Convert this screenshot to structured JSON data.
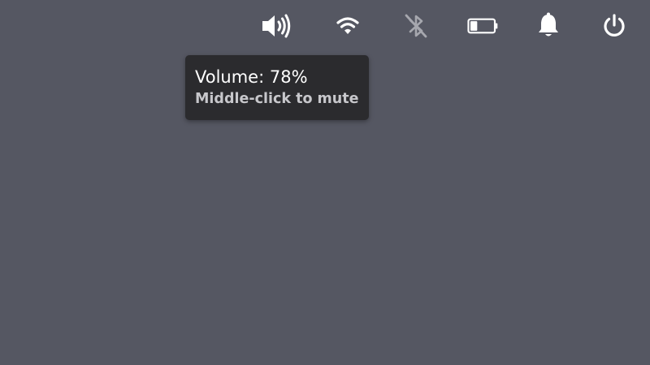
{
  "tray": {
    "icons": [
      {
        "name": "volume-icon"
      },
      {
        "name": "wifi-icon"
      },
      {
        "name": "bluetooth-disabled-icon"
      },
      {
        "name": "battery-icon",
        "level": 0.3
      },
      {
        "name": "bell-icon"
      },
      {
        "name": "power-icon"
      }
    ]
  },
  "tooltip": {
    "title": "Volume: 78%",
    "subtitle": "Middle-click to mute"
  },
  "colors": {
    "desktop_background": "#555762",
    "tooltip_background": "#2b2b2e",
    "icon_active": "#ffffff",
    "icon_dimmed": "#a6a7ae"
  }
}
